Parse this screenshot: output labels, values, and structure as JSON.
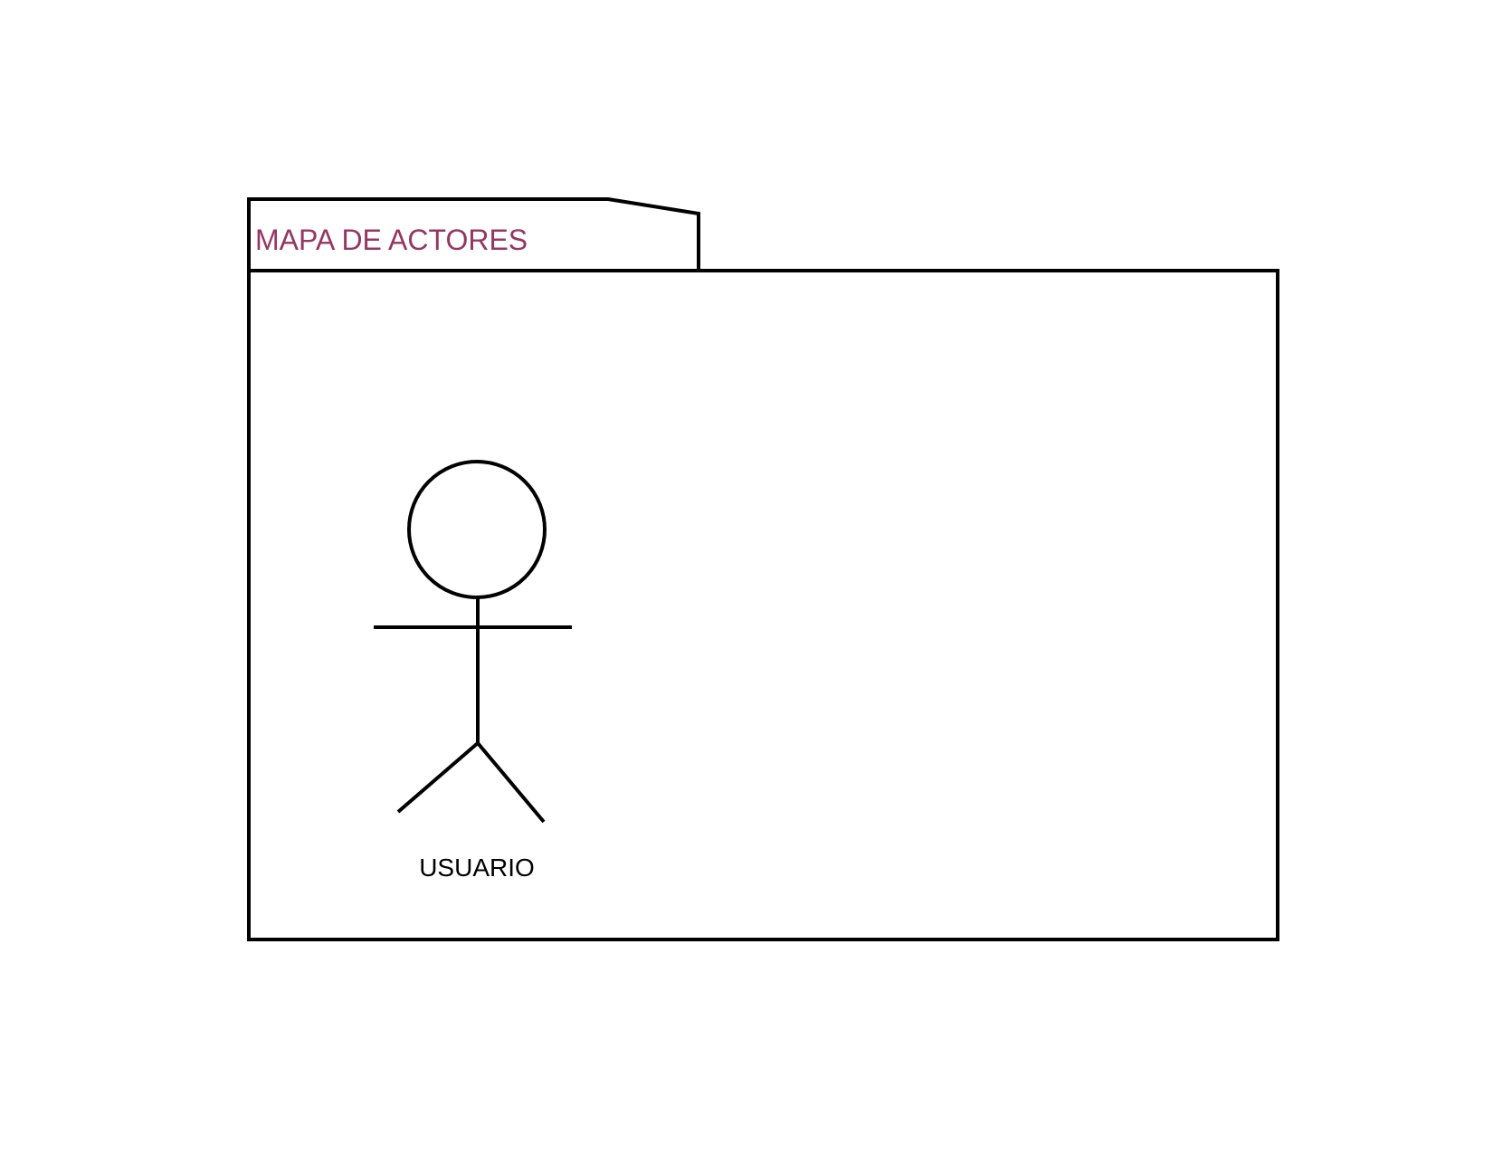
{
  "package": {
    "title": "MAPA DE ACTORES",
    "title_color": "#943764"
  },
  "actors": [
    {
      "name": "USUARIO"
    }
  ],
  "colors": {
    "stroke": "#000000",
    "background": "#ffffff",
    "actor_label": "#000000"
  }
}
